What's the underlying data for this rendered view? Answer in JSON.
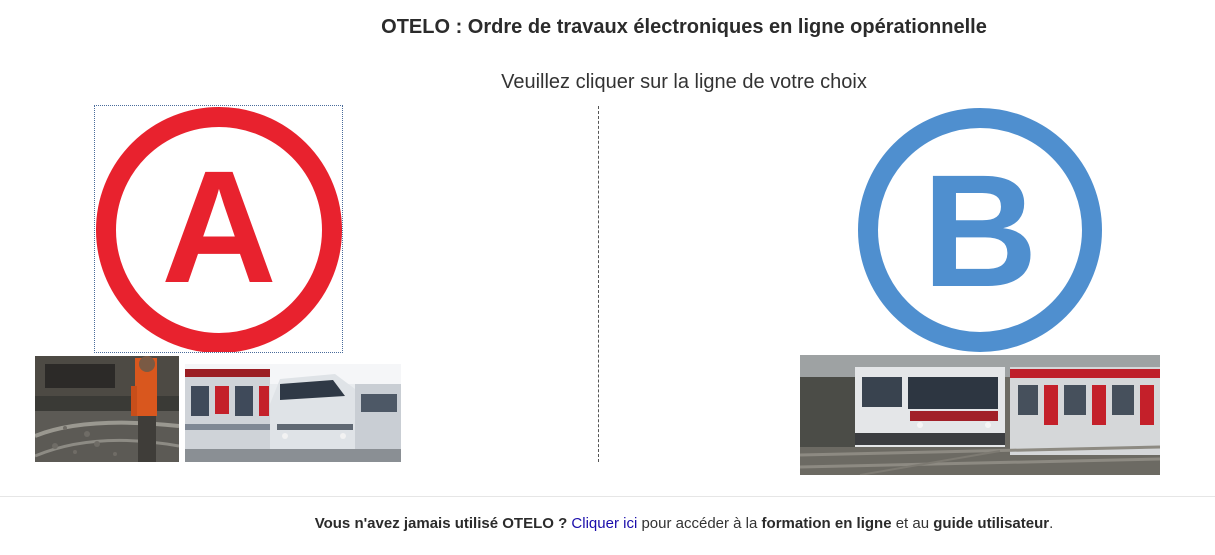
{
  "header": {
    "title": "OTELO : Ordre de travaux électroniques en ligne opérationnelle",
    "subtitle": "Veuillez cliquer sur la ligne de votre choix"
  },
  "lines": [
    {
      "letter": "A",
      "color": "#e8222e"
    },
    {
      "letter": "B",
      "color": "#4f8fcf"
    }
  ],
  "icons": {
    "line_a": "line-a-logo-icon",
    "line_b": "line-b-logo-icon"
  },
  "footer": {
    "question": "Vous n'avez jamais utilisé OTELO ?",
    "link": "Cliquer ici",
    "text1": " pour accéder à la ",
    "formation": "formation en ligne",
    "text2": " et au ",
    "guide": "guide utilisateur",
    "end": "."
  }
}
